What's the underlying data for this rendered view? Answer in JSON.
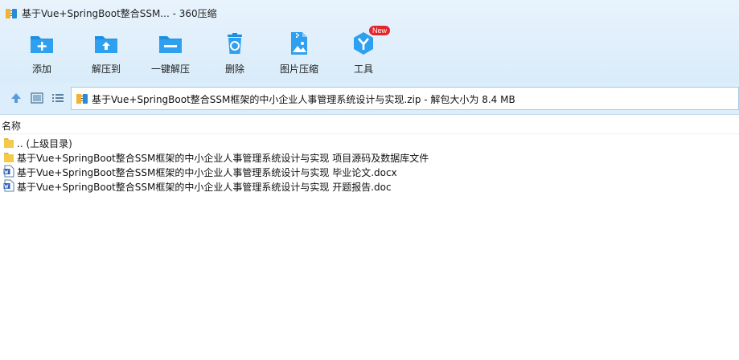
{
  "window": {
    "title": "基于Vue+SpringBoot整合SSM... - 360压缩"
  },
  "toolbar": {
    "items": [
      {
        "label": "添加",
        "icon": "add-folder-icon"
      },
      {
        "label": "解压到",
        "icon": "extract-to-icon"
      },
      {
        "label": "一键解压",
        "icon": "one-click-extract-icon"
      },
      {
        "label": "删除",
        "icon": "recycle-bin-icon"
      },
      {
        "label": "图片压缩",
        "icon": "image-compress-icon"
      },
      {
        "label": "工具",
        "icon": "tools-icon",
        "badge": "New"
      }
    ]
  },
  "address": {
    "text": "基于Vue+SpringBoot整合SSM框架的中小企业人事管理系统设计与实现.zip - 解包大小为 8.4 MB"
  },
  "list": {
    "header_name": "名称",
    "rows": [
      {
        "name": ".. (上级目录)",
        "icon": "parent-folder-icon"
      },
      {
        "name": "基于Vue+SpringBoot整合SSM框架的中小企业人事管理系统设计与实现 项目源码及数据库文件",
        "icon": "folder-icon"
      },
      {
        "name": "基于Vue+SpringBoot整合SSM框架的中小企业人事管理系统设计与实现 毕业论文.docx",
        "icon": "word-doc-icon"
      },
      {
        "name": "基于Vue+SpringBoot整合SSM框架的中小企业人事管理系统设计与实现 开题报告.doc",
        "icon": "word-doc-icon"
      }
    ]
  },
  "colors": {
    "toolbar_icon_blue": "#1d8fe0",
    "badge_red": "#e4262b",
    "folder_yellow": "#f5c94a"
  }
}
